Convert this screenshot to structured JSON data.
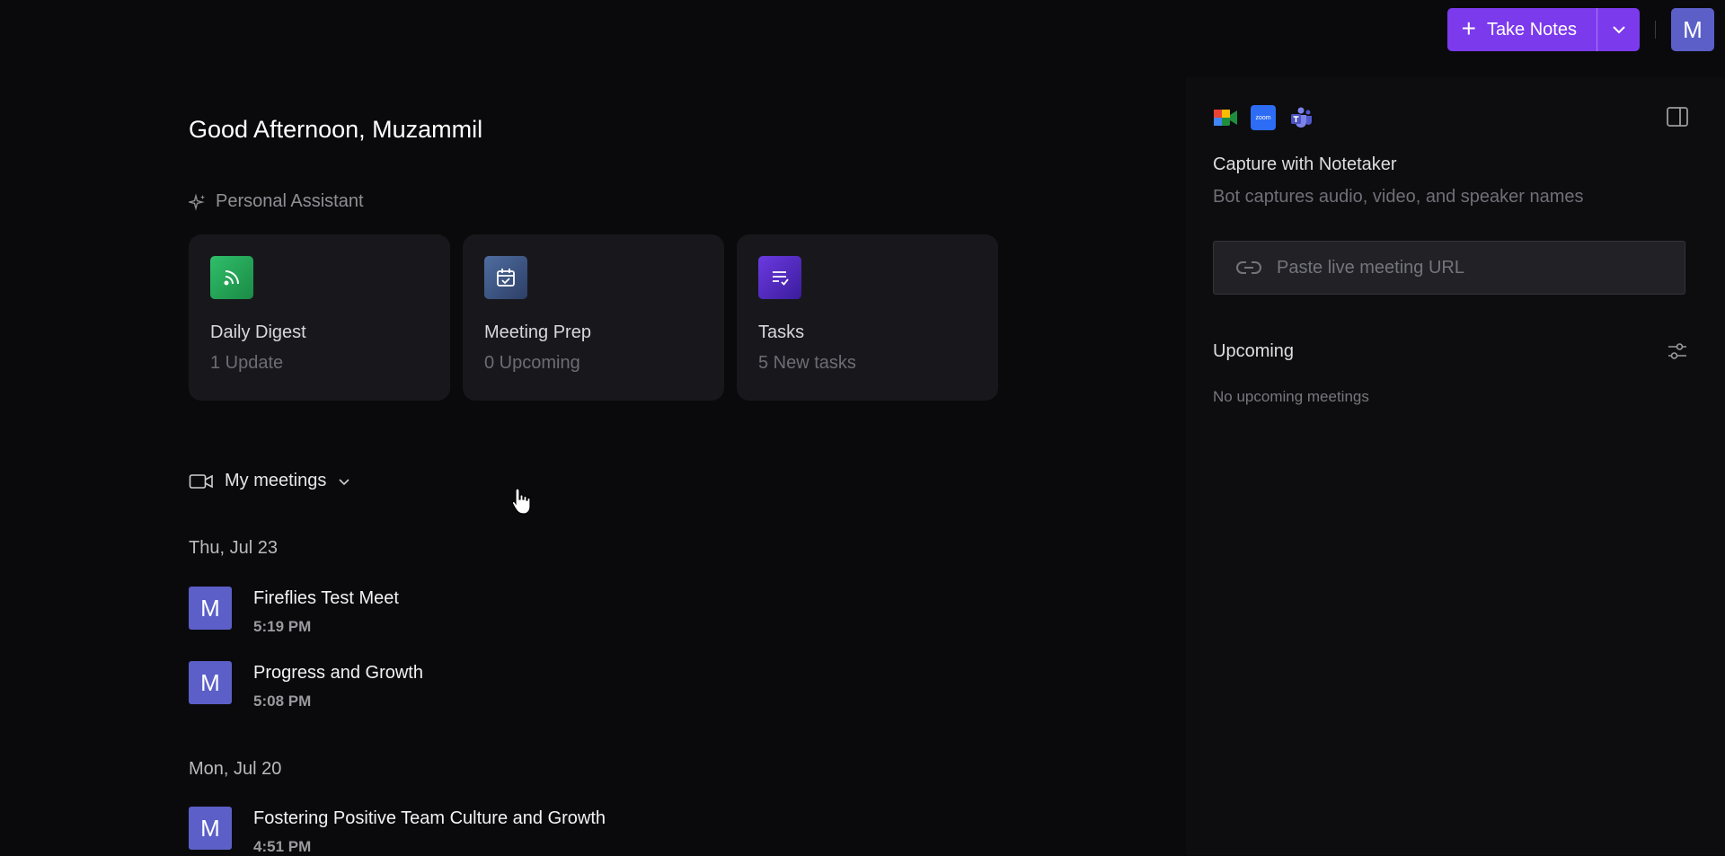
{
  "header": {
    "take_notes_label": "Take Notes",
    "avatar_initial": "M"
  },
  "main": {
    "greeting": "Good Afternoon, Muzammil",
    "assistant_label": "Personal Assistant",
    "cards": [
      {
        "title": "Daily Digest",
        "subtitle": "1 Update",
        "icon": "rss-icon",
        "color": "#22a35a"
      },
      {
        "title": "Meeting Prep",
        "subtitle": "0 Upcoming",
        "icon": "calendar-check-icon",
        "color": "#3f5a86"
      },
      {
        "title": "Tasks",
        "subtitle": "5 New tasks",
        "icon": "checklist-icon",
        "color": "#5b2dc9"
      }
    ],
    "meetings_filter_label": "My meetings",
    "days": [
      {
        "label": "Thu, Jul 23",
        "meetings": [
          {
            "initial": "M",
            "title": "Fireflies Test Meet",
            "time": "5:19 PM"
          },
          {
            "initial": "M",
            "title": "Progress and Growth",
            "time": "5:08 PM"
          }
        ]
      },
      {
        "label": "Mon, Jul 20",
        "meetings": [
          {
            "initial": "M",
            "title": "Fostering Positive Team Culture and Growth",
            "time": "4:51 PM"
          }
        ]
      }
    ]
  },
  "right_panel": {
    "zoom_label": "zoom",
    "capture_title": "Capture with Notetaker",
    "capture_subtitle": "Bot captures audio, video, and speaker names",
    "url_placeholder": "Paste live meeting URL",
    "upcoming_title": "Upcoming",
    "upcoming_empty": "No upcoming meetings"
  },
  "colors": {
    "accent": "#7c3aed",
    "avatar": "#5b5fc7",
    "background": "#0a0a0c",
    "card": "#18181c"
  }
}
